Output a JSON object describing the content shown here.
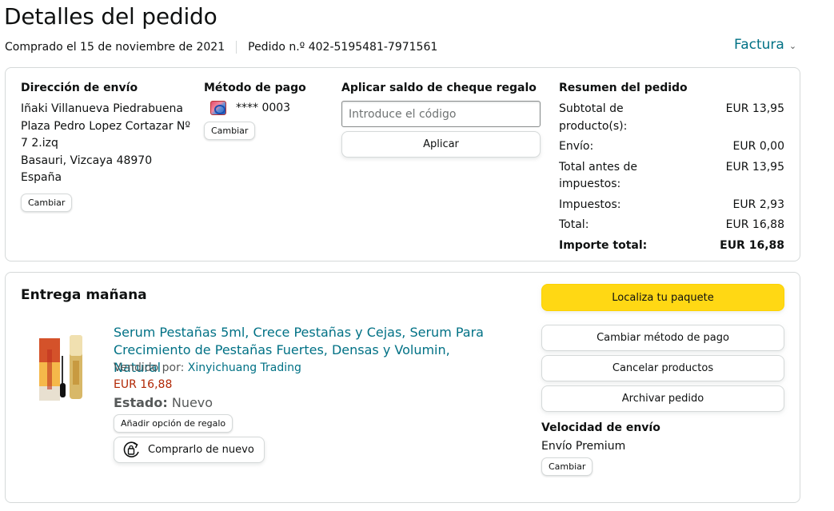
{
  "page": {
    "title": "Detalles del pedido",
    "purchase_date": "Comprado el 15 de noviembre de 2021",
    "order_number": "Pedido n.º 402-5195481-7971561",
    "invoice_label": "Factura"
  },
  "shipping": {
    "title": "Dirección de envío",
    "name": "Iñaki Villanueva Piedrabuena",
    "line1": "Plaza Pedro Lopez Cortazar Nº 7 2.izq",
    "line2": "Basauri, Vizcaya 48970",
    "country": "España",
    "change_label": "Cambiar"
  },
  "payment": {
    "title": "Método de pago",
    "card_number": "**** 0003",
    "change_label": "Cambiar"
  },
  "gift_card": {
    "title": "Aplicar saldo de cheque regalo",
    "placeholder": "Introduce el código",
    "apply_label": "Aplicar"
  },
  "summary": {
    "title": "Resumen del pedido",
    "rows": [
      {
        "label": "Subtotal de producto(s):",
        "value": "EUR 13,95"
      },
      {
        "label": "Envío:",
        "value": "EUR 0,00"
      },
      {
        "label": "Total antes de impuestos:",
        "value": "EUR 13,95"
      },
      {
        "label": "Impuestos:",
        "value": "EUR 2,93"
      },
      {
        "label": "Total:",
        "value": "EUR 16,88"
      },
      {
        "label": "Importe total:",
        "value": "EUR 16,88"
      }
    ]
  },
  "delivery": {
    "title": "Entrega mañana",
    "product_title": "Serum Pestañas 5ml, Crece Pestañas y Cejas, Serum Para Crecimiento de Pestañas Fuertes, Densas y Volumin, Natural",
    "sold_by_label": "Vendido por:",
    "seller": "Xinyichuang Trading",
    "price": "EUR 16,88",
    "state_label": "Estado:",
    "state_value": "Nuevo",
    "gift_option_label": "Añadir opción de regalo",
    "buy_again_label": "Comprarlo de nuevo"
  },
  "actions": {
    "track_label": "Localiza tu paquete",
    "change_payment_label": "Cambiar método de pago",
    "cancel_label": "Cancelar productos",
    "archive_label": "Archivar pedido",
    "speed_title": "Velocidad de envío",
    "speed_value": "Envío Premium",
    "speed_change_label": "Cambiar"
  },
  "colors": {
    "link": "#007185",
    "price": "#B12704",
    "primary_button": "#FFD814",
    "border": "#D5D9D9"
  },
  "icons": [
    "chevron-down-icon",
    "credit-card-icon",
    "rebuy-icon"
  ]
}
